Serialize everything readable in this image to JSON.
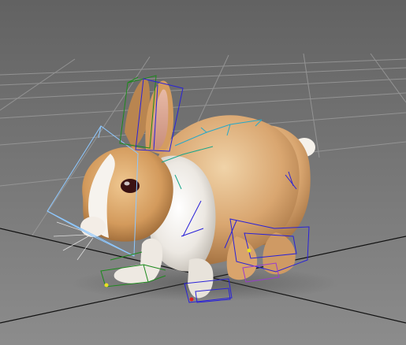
{
  "viewport": {
    "background_top": "#626262",
    "background_bottom": "#8c8c8c",
    "grid_color": "#9a9a9a",
    "axis_color": "#111111",
    "rig_colors": {
      "blue": "#2a22d8",
      "green": "#1c8a1c",
      "cyan": "#27a8c8",
      "light_blue": "#8ec8ff",
      "teal": "#1aa58a",
      "purple": "#9a3ad0"
    },
    "subject": {
      "icon": "rabbit-icon",
      "fur_main": "#d6a56c",
      "fur_light": "#f3efe8",
      "eye": "#3a1212"
    }
  }
}
